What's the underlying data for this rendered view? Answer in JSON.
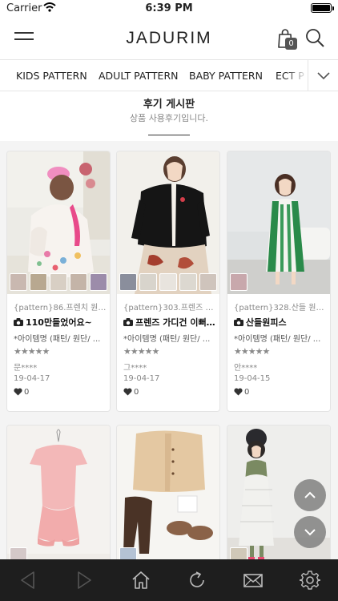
{
  "status_bar": {
    "carrier": "Carrier",
    "time": "6:39 PM"
  },
  "header": {
    "logo": "JADURIM",
    "cart_count": "0"
  },
  "tabs": [
    {
      "label": "KIDS PATTERN"
    },
    {
      "label": "ADULT PATTERN"
    },
    {
      "label": "BABY PATTERN"
    },
    {
      "label": "ECT P"
    }
  ],
  "board": {
    "title": "후기 게시판",
    "subtitle": "상품 사용후기입니다."
  },
  "reviews": [
    {
      "pattern": "{pattern}86.프렌치 원피...",
      "title": "110만들었어요~",
      "item": "*아이템명 (패턴/ 원단/ ...",
      "stars": "★★★★★",
      "author": "문****",
      "date": "19-04-17",
      "likes": "0"
    },
    {
      "pattern": "{pattern}303.프렌즈 가...",
      "title": "프렌즈 가디건 이뻐...",
      "item": "*아이템명 (패턴/ 원단/ ...",
      "stars": "★★★★★",
      "author": "그****",
      "date": "19-04-17",
      "likes": "0"
    },
    {
      "pattern": "{pattern}328.산들 원피...",
      "title": "산들원피스",
      "item": "*아이템명 (패턴/ 원단/ ...",
      "stars": "★★★★★",
      "author": "안****",
      "date": "19-04-15",
      "likes": "0"
    }
  ],
  "icons": {
    "menu": "hamburger-icon",
    "cart": "bag-icon",
    "search": "search-icon",
    "more": "chevron-down-icon",
    "camera": "camera-icon",
    "like": "heart-icon",
    "scroll_up": "chevron-up-icon",
    "scroll_down": "chevron-down-icon",
    "back": "triangle-left-icon",
    "forward": "triangle-right-icon",
    "home": "home-icon",
    "refresh": "refresh-icon",
    "mail": "envelope-icon",
    "settings": "gear-icon"
  },
  "colors": {
    "accent": "#222222",
    "nav_bg": "#1e1e1e",
    "fab": "#808080",
    "star": "#8a8a8a"
  }
}
